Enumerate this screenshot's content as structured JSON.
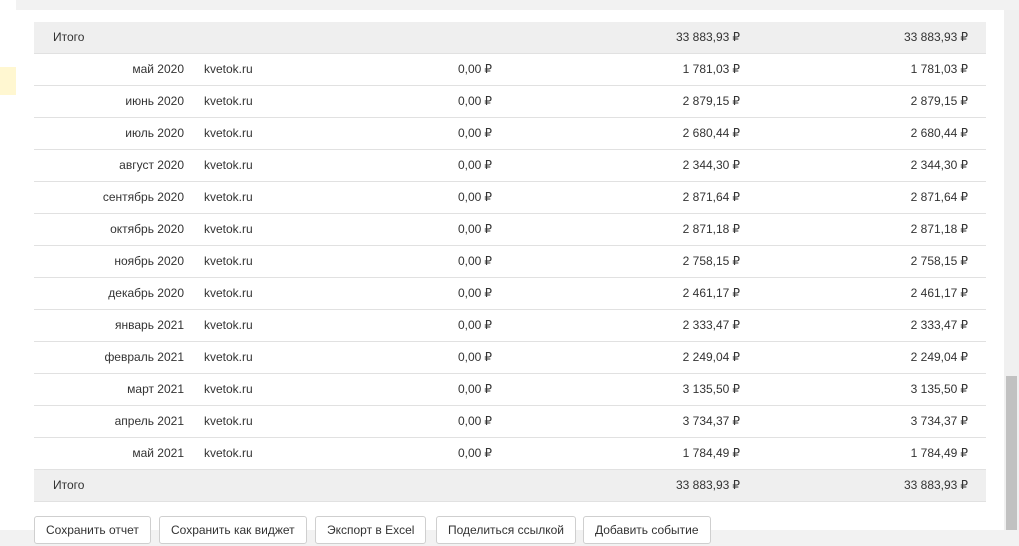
{
  "currency_symbol": "₽",
  "table": {
    "top_total": {
      "label": "Итого",
      "a": "",
      "b": "33 883,93",
      "c": "33 883,93"
    },
    "rows": [
      {
        "month": "май 2020",
        "site": "kvetok.ru",
        "a": "0,00",
        "b": "1 781,03",
        "c": "1 781,03"
      },
      {
        "month": "июнь 2020",
        "site": "kvetok.ru",
        "a": "0,00",
        "b": "2 879,15",
        "c": "2 879,15"
      },
      {
        "month": "июль 2020",
        "site": "kvetok.ru",
        "a": "0,00",
        "b": "2 680,44",
        "c": "2 680,44"
      },
      {
        "month": "август 2020",
        "site": "kvetok.ru",
        "a": "0,00",
        "b": "2 344,30",
        "c": "2 344,30"
      },
      {
        "month": "сентябрь 2020",
        "site": "kvetok.ru",
        "a": "0,00",
        "b": "2 871,64",
        "c": "2 871,64"
      },
      {
        "month": "октябрь 2020",
        "site": "kvetok.ru",
        "a": "0,00",
        "b": "2 871,18",
        "c": "2 871,18"
      },
      {
        "month": "ноябрь 2020",
        "site": "kvetok.ru",
        "a": "0,00",
        "b": "2 758,15",
        "c": "2 758,15"
      },
      {
        "month": "декабрь 2020",
        "site": "kvetok.ru",
        "a": "0,00",
        "b": "2 461,17",
        "c": "2 461,17"
      },
      {
        "month": "январь 2021",
        "site": "kvetok.ru",
        "a": "0,00",
        "b": "2 333,47",
        "c": "2 333,47"
      },
      {
        "month": "февраль 2021",
        "site": "kvetok.ru",
        "a": "0,00",
        "b": "2 249,04",
        "c": "2 249,04"
      },
      {
        "month": "март 2021",
        "site": "kvetok.ru",
        "a": "0,00",
        "b": "3 135,50",
        "c": "3 135,50"
      },
      {
        "month": "апрель 2021",
        "site": "kvetok.ru",
        "a": "0,00",
        "b": "3 734,37",
        "c": "3 734,37"
      },
      {
        "month": "май 2021",
        "site": "kvetok.ru",
        "a": "0,00",
        "b": "1 784,49",
        "c": "1 784,49"
      }
    ],
    "bottom_total": {
      "label": "Итого",
      "a": "",
      "b": "33 883,93",
      "c": "33 883,93"
    }
  },
  "actions": {
    "save_report": "Сохранить отчет",
    "save_widget": "Сохранить как виджет",
    "export_excel": "Экспорт в Excel",
    "share_link": "Поделиться ссылкой",
    "add_event": "Добавить событие"
  }
}
